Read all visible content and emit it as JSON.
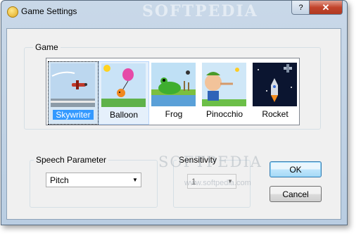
{
  "window": {
    "title": "Game Settings",
    "help_glyph": "?",
    "close_glyph": "✕",
    "watermark": "SOFTPEDIA"
  },
  "game_group": {
    "label": "Game",
    "items": [
      {
        "label": "Skywriter",
        "selected": true
      },
      {
        "label": "Balloon"
      },
      {
        "label": "Frog"
      },
      {
        "label": "Pinocchio"
      },
      {
        "label": "Rocket"
      }
    ]
  },
  "speech": {
    "label": "Speech Parameter",
    "value": "Pitch",
    "arrow": "▼"
  },
  "sensitivity": {
    "label": "Sensitivity",
    "value": "1",
    "arrow": "▼"
  },
  "buttons": {
    "ok": "OK",
    "cancel": "Cancel"
  },
  "watermark": {
    "text": "SOFTPEDIA",
    "sub": "www.softpedia.com"
  }
}
